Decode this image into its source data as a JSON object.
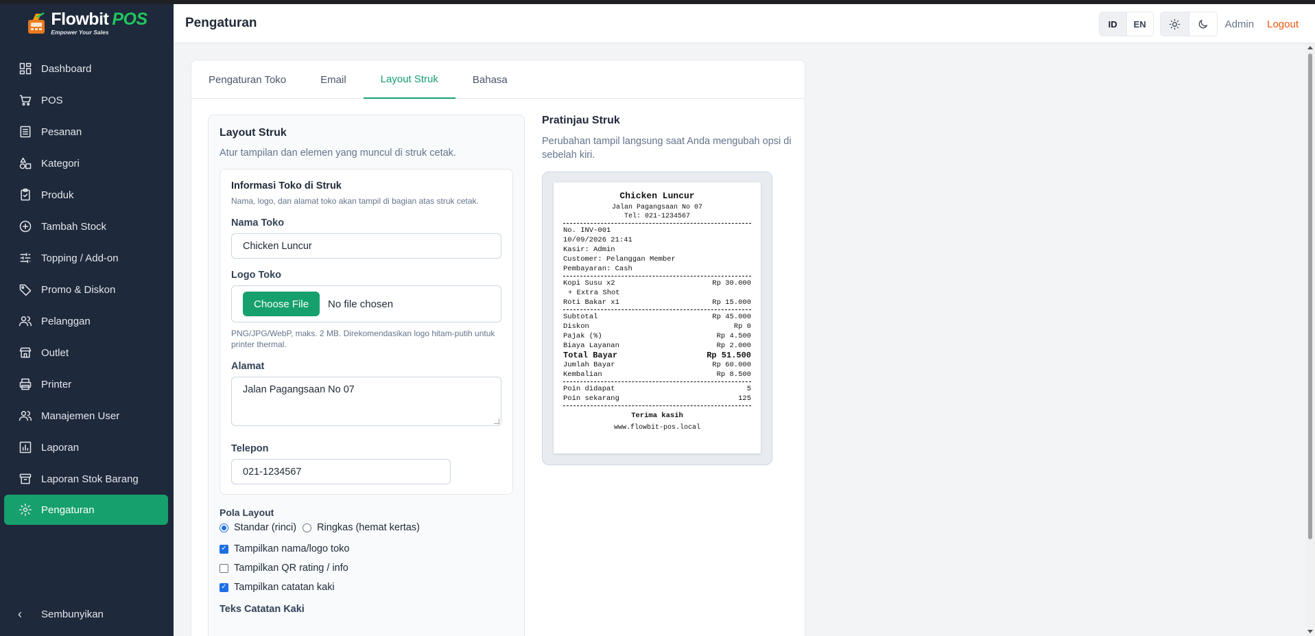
{
  "app": {
    "brand_name": "Flowbit",
    "brand_pos": "POS",
    "brand_tagline": "Empower Your Sales"
  },
  "sidebar": {
    "items": [
      {
        "label": "Dashboard",
        "icon": "dashboard-icon"
      },
      {
        "label": "POS",
        "icon": "cart-icon"
      },
      {
        "label": "Pesanan",
        "icon": "receipt-icon"
      },
      {
        "label": "Kategori",
        "icon": "shapes-icon"
      },
      {
        "label": "Produk",
        "icon": "clipboard-icon"
      },
      {
        "label": "Tambah Stock",
        "icon": "plus-circle-icon"
      },
      {
        "label": "Topping / Add-on",
        "icon": "sliders-icon"
      },
      {
        "label": "Promo & Diskon",
        "icon": "tag-icon"
      },
      {
        "label": "Pelanggan",
        "icon": "users-icon"
      },
      {
        "label": "Outlet",
        "icon": "store-icon"
      },
      {
        "label": "Printer",
        "icon": "printer-icon"
      },
      {
        "label": "Manajemen User",
        "icon": "user-group-icon"
      },
      {
        "label": "Laporan",
        "icon": "chart-icon"
      },
      {
        "label": "Laporan Stok Barang",
        "icon": "archive-icon"
      },
      {
        "label": "Pengaturan",
        "icon": "gear-icon"
      }
    ],
    "active_item": "Pengaturan",
    "hide_label": "Sembunyikan"
  },
  "header": {
    "title": "Pengaturan",
    "lang_options": [
      "ID",
      "EN"
    ],
    "selected_lang": "ID",
    "user": "Admin",
    "logout": "Logout"
  },
  "tabs": [
    "Pengaturan Toko",
    "Email",
    "Layout Struk",
    "Bahasa"
  ],
  "active_tab": "Layout Struk",
  "layout": {
    "title": "Layout Struk",
    "subtitle": "Atur tampilan dan elemen yang muncul di struk cetak.",
    "info_title": "Informasi Toko di Struk",
    "info_desc": "Nama, logo, dan alamat toko akan tampil di bagian atas struk cetak.",
    "store_name_label": "Nama Toko",
    "store_name_value": "Chicken Luncur",
    "logo_label": "Logo Toko",
    "choose_file": "Choose File",
    "no_file": "No file chosen",
    "logo_hint": "PNG/JPG/WebP, maks. 2 MB. Direkomendasikan logo hitam-putih untuk printer thermal.",
    "address_label": "Alamat",
    "address_value": "Jalan Pagangsaan No 07",
    "phone_label": "Telepon",
    "phone_value": "021-1234567",
    "pattern_label": "Pola Layout",
    "pattern_standard": "Standar (rinci)",
    "pattern_compact": "Ringkas (hemat kertas)",
    "pattern_selected": "Standar (rinci)",
    "opt_show_name": "Tampilkan nama/logo toko",
    "opt_show_name_checked": true,
    "opt_show_qr": "Tampilkan QR rating / info",
    "opt_show_qr_checked": false,
    "opt_show_footer": "Tampilkan catatan kaki",
    "opt_show_footer_checked": true,
    "footer_text_label": "Teks Catatan Kaki"
  },
  "preview": {
    "title": "Pratinjau Struk",
    "subtitle": "Perubahan tampil langsung saat Anda mengubah opsi di sebelah kiri.",
    "receipt": {
      "store": "Chicken Luncur",
      "address": "Jalan Pagangsaan No 07",
      "phone": "Tel: 021-1234567",
      "invoice": "No. INV-001",
      "datetime": "10/09/2026 21:41",
      "cashier": "Kasir: Admin",
      "customer": "Customer: Pelanggan Member",
      "payment": "Pembayaran: Cash",
      "items": [
        {
          "name": "Kopi Susu x2",
          "price": "Rp 30.000"
        },
        {
          "name": "Roti Bakar x1",
          "price": "Rp 15.000"
        }
      ],
      "addon": "+ Extra Shot",
      "subtotal_label": "Subtotal",
      "subtotal": "Rp 45.000",
      "discount_label": "Diskon",
      "discount": "Rp 0",
      "tax_label": "Pajak (%)",
      "tax": "Rp 4.500",
      "service_label": "Biaya Layanan",
      "service": "Rp 2.000",
      "total_label": "Total Bayar",
      "total": "Rp 51.500",
      "paid_label": "Jumlah Bayar",
      "paid": "Rp 60.000",
      "change_label": "Kembalian",
      "change": "Rp 8.500",
      "points_earned_label": "Poin didapat",
      "points_earned": "5",
      "points_now_label": "Poin sekarang",
      "points_now": "125",
      "thanks": "Terima kasih",
      "website": "www.flowbit-pos.local"
    }
  },
  "colors": {
    "sidebar_bg": "#1e293b",
    "accent": "#16a06d",
    "logout": "#ea580c"
  }
}
